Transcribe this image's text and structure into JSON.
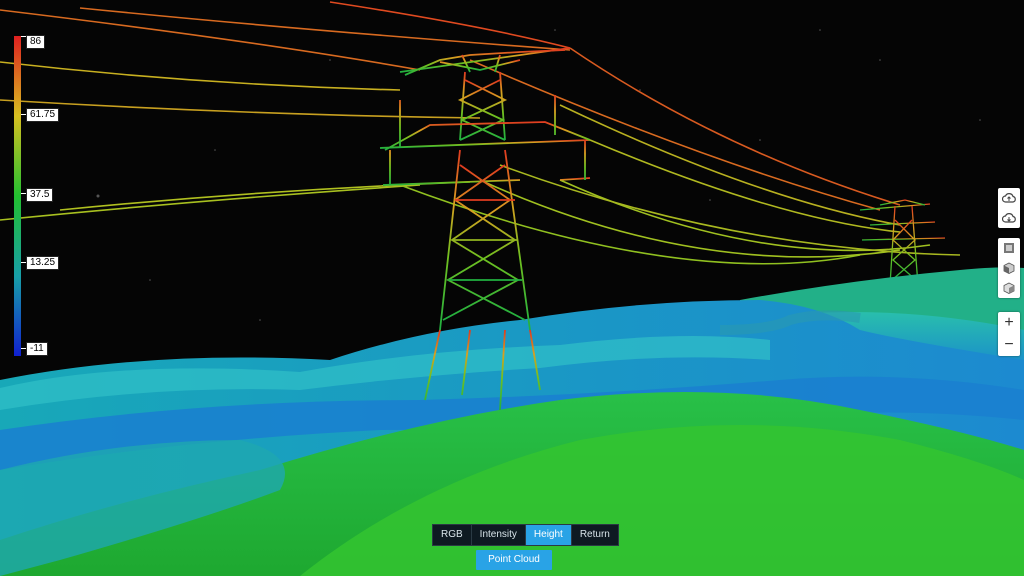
{
  "legend": {
    "labels": [
      "86",
      "61.75",
      "37.5",
      "13.25",
      "-11"
    ],
    "max": 86,
    "min": -11
  },
  "toolbar": {
    "cloud_upload_icon": "cloud-upload-icon",
    "cloud_download_icon": "cloud-download-icon",
    "view_icons": [
      "grid-view-icon",
      "cube-icon",
      "box-icon"
    ],
    "zoom_in_label": "+",
    "zoom_out_label": "−"
  },
  "modes": {
    "tabs": [
      "RGB",
      "Intensity",
      "Height",
      "Return"
    ],
    "active": "Height"
  },
  "point_cloud_button": "Point Cloud",
  "colors": {
    "active_tab": "#29a3e6",
    "scale_high": "#e02020",
    "scale_mid_high": "#d8c020",
    "scale_mid": "#22c030",
    "scale_mid_low": "#18a0a8",
    "scale_low": "#1020d0"
  }
}
